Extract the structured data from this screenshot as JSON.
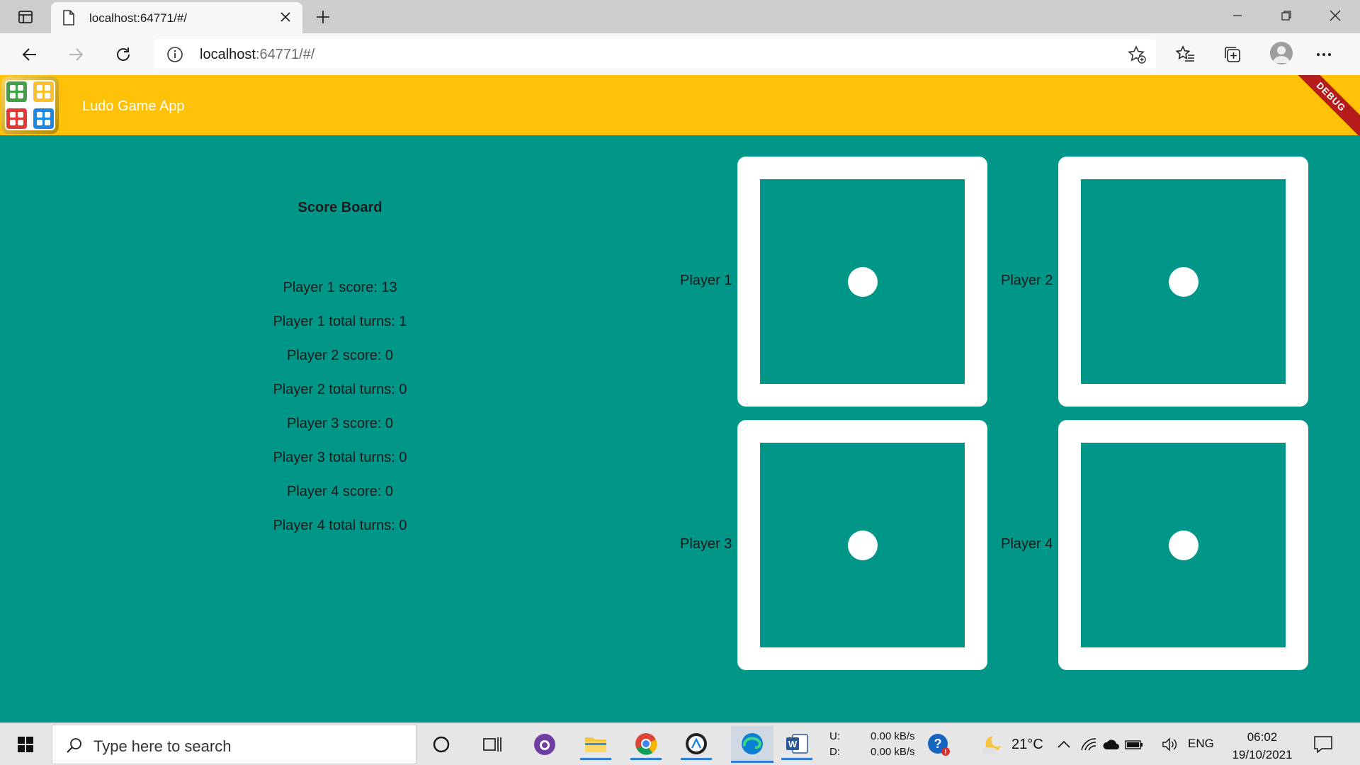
{
  "browser": {
    "tab_title": "localhost:64771/#/",
    "url_host": "localhost",
    "url_rest": ":64771/#/"
  },
  "app": {
    "title": "Ludo Game App",
    "debug_banner": "DEBUG",
    "accent_color": "#ffc107",
    "background_color": "#009688"
  },
  "scoreboard": {
    "title": "Score Board",
    "lines": [
      "Player 1 score: 13",
      "Player 1 total turns: 1",
      "Player 2 score: 0",
      "Player 2 total turns: 0",
      "Player 3 score: 0",
      "Player 3 total turns: 0",
      "Player 4 score: 0",
      "Player 4 total turns: 0"
    ]
  },
  "dice": [
    {
      "player": "Player 1",
      "value": 1
    },
    {
      "player": "Player 2",
      "value": 1
    },
    {
      "player": "Player 3",
      "value": 1
    },
    {
      "player": "Player 4",
      "value": 1
    }
  ],
  "taskbar": {
    "search_placeholder": "Type here to search",
    "net_label_u": "U:",
    "net_label_d": "D:",
    "net_up": "0.00 kB/s",
    "net_down": "0.00 kB/s",
    "weather": "21°C",
    "language": "ENG",
    "time": "06:02",
    "date": "19/10/2021",
    "pinned": [
      "cortana-icon",
      "task-view-icon",
      "github-desktop-icon",
      "file-explorer-icon",
      "chrome-icon",
      "app-icon",
      "edge-icon",
      "word-icon"
    ]
  }
}
